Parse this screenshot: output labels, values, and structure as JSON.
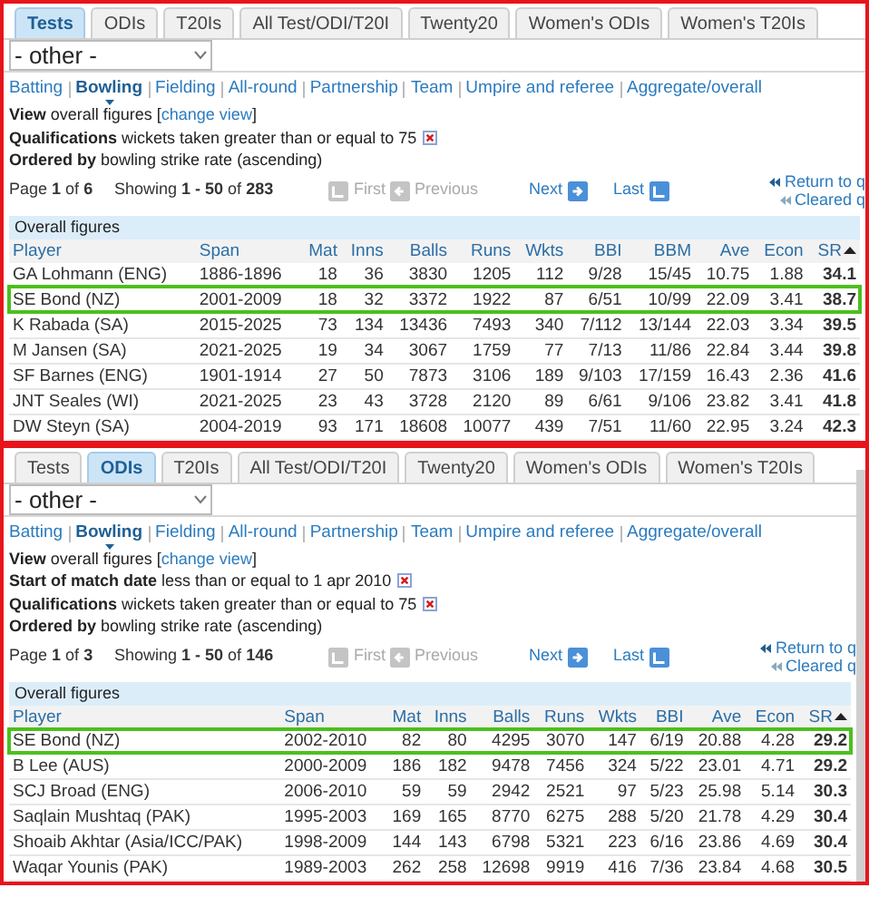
{
  "panels": [
    {
      "tabs": [
        {
          "label": "Tests",
          "selected": true
        },
        {
          "label": "ODIs",
          "selected": false
        },
        {
          "label": "T20Is",
          "selected": false
        },
        {
          "label": "All Test/ODI/T20I",
          "selected": false
        },
        {
          "label": "Twenty20",
          "selected": false
        },
        {
          "label": "Women's ODIs",
          "selected": false
        },
        {
          "label": "Women's T20Is",
          "selected": false
        }
      ],
      "select": "- other -",
      "nav": [
        {
          "label": "Batting",
          "selected": false
        },
        {
          "label": "Bowling",
          "selected": true
        },
        {
          "label": "Fielding",
          "selected": false
        },
        {
          "label": "All-round",
          "selected": false
        },
        {
          "label": "Partnership",
          "selected": false
        },
        {
          "label": "Team",
          "selected": false
        },
        {
          "label": "Umpire and referee",
          "selected": false
        },
        {
          "label": "Aggregate/overall",
          "selected": false
        }
      ],
      "filters": [
        {
          "label": "View",
          "text": "overall figures [",
          "link": "change view",
          "after": "]",
          "removable": false
        },
        {
          "label": "Qualifications",
          "text": "wickets taken greater than or equal to 75",
          "removable": true
        },
        {
          "label": "Ordered by",
          "text": "bowling strike rate (ascending)",
          "removable": false
        }
      ],
      "pager": {
        "page": "Page **1** of **6**",
        "showing": "Showing **1 - 50** of **283**",
        "buttons": [
          {
            "label": "First",
            "kind": "first",
            "disabled": true
          },
          {
            "label": "Previous",
            "kind": "previous",
            "disabled": true
          },
          {
            "label": "Next",
            "kind": "next",
            "disabled": false
          },
          {
            "label": "Last",
            "kind": "last",
            "disabled": false
          }
        ],
        "links": [
          "Return to q",
          "Cleared q"
        ]
      },
      "table": {
        "caption": "Overall figures",
        "columns": [
          {
            "label": "Player",
            "kind": "text",
            "sorted": false
          },
          {
            "label": "Span",
            "kind": "text",
            "sorted": false
          },
          {
            "label": "Mat",
            "kind": "number",
            "sorted": false
          },
          {
            "label": "Inns",
            "kind": "number",
            "sorted": false
          },
          {
            "label": "Balls",
            "kind": "number",
            "sorted": false
          },
          {
            "label": "Runs",
            "kind": "number",
            "sorted": false
          },
          {
            "label": "Wkts",
            "kind": "number",
            "sorted": false
          },
          {
            "label": "BBI",
            "kind": "number",
            "sorted": false
          },
          {
            "label": "BBM",
            "kind": "number",
            "sorted": false
          },
          {
            "label": "Ave",
            "kind": "number",
            "sorted": false
          },
          {
            "label": "Econ",
            "kind": "number",
            "sorted": false
          },
          {
            "label": "SR",
            "kind": "number",
            "sorted": true
          }
        ],
        "rows": [
          {
            "highlighted": false,
            "cells": [
              "GA Lohmann (ENG)",
              "1886-1896",
              "18",
              "36",
              "3830",
              "1205",
              "112",
              "9/28",
              "15/45",
              "10.75",
              "1.88",
              "34.1"
            ]
          },
          {
            "highlighted": true,
            "cells": [
              "SE Bond (NZ)",
              "2001-2009",
              "18",
              "32",
              "3372",
              "1922",
              "87",
              "6/51",
              "10/99",
              "22.09",
              "3.41",
              "38.7"
            ]
          },
          {
            "highlighted": false,
            "cells": [
              "K Rabada (SA)",
              "2015-2025",
              "73",
              "134",
              "13436",
              "7493",
              "340",
              "7/112",
              "13/144",
              "22.03",
              "3.34",
              "39.5"
            ]
          },
          {
            "highlighted": false,
            "cells": [
              "M Jansen (SA)",
              "2021-2025",
              "19",
              "34",
              "3067",
              "1759",
              "77",
              "7/13",
              "11/86",
              "22.84",
              "3.44",
              "39.8"
            ]
          },
          {
            "highlighted": false,
            "cells": [
              "SF Barnes (ENG)",
              "1901-1914",
              "27",
              "50",
              "7873",
              "3106",
              "189",
              "9/103",
              "17/159",
              "16.43",
              "2.36",
              "41.6"
            ]
          },
          {
            "highlighted": false,
            "cells": [
              "JNT Seales (WI)",
              "2021-2025",
              "23",
              "43",
              "3728",
              "2120",
              "89",
              "6/61",
              "9/106",
              "23.82",
              "3.41",
              "41.8"
            ]
          },
          {
            "highlighted": false,
            "cells": [
              "DW Steyn (SA)",
              "2004-2019",
              "93",
              "171",
              "18608",
              "10077",
              "439",
              "7/51",
              "11/60",
              "22.95",
              "3.24",
              "42.3"
            ]
          }
        ]
      }
    },
    {
      "tabs": [
        {
          "label": "Tests",
          "selected": false
        },
        {
          "label": "ODIs",
          "selected": true
        },
        {
          "label": "T20Is",
          "selected": false
        },
        {
          "label": "All Test/ODI/T20I",
          "selected": false
        },
        {
          "label": "Twenty20",
          "selected": false
        },
        {
          "label": "Women's ODIs",
          "selected": false
        },
        {
          "label": "Women's T20Is",
          "selected": false
        }
      ],
      "select": "- other -",
      "nav": [
        {
          "label": "Batting",
          "selected": false
        },
        {
          "label": "Bowling",
          "selected": true
        },
        {
          "label": "Fielding",
          "selected": false
        },
        {
          "label": "All-round",
          "selected": false
        },
        {
          "label": "Partnership",
          "selected": false
        },
        {
          "label": "Team",
          "selected": false
        },
        {
          "label": "Umpire and referee",
          "selected": false
        },
        {
          "label": "Aggregate/overall",
          "selected": false
        }
      ],
      "filters": [
        {
          "label": "View",
          "text": "overall figures [",
          "link": "change view",
          "after": "]",
          "removable": false
        },
        {
          "label": "Start of match date",
          "text": "less than or equal to 1 apr 2010",
          "removable": true
        },
        {
          "label": "Qualifications",
          "text": "wickets taken greater than or equal to 75",
          "removable": true
        },
        {
          "label": "Ordered by",
          "text": "bowling strike rate (ascending)",
          "removable": false
        }
      ],
      "pager": {
        "page": "Page **1** of **3**",
        "showing": "Showing **1 - 50** of **146**",
        "buttons": [
          {
            "label": "First",
            "kind": "first",
            "disabled": true
          },
          {
            "label": "Previous",
            "kind": "previous",
            "disabled": true
          },
          {
            "label": "Next",
            "kind": "next",
            "disabled": false
          },
          {
            "label": "Last",
            "kind": "last",
            "disabled": false
          }
        ],
        "links": [
          "Return to q",
          "Cleared q"
        ]
      },
      "table": {
        "caption": "Overall figures",
        "columns": [
          {
            "label": "Player",
            "kind": "text",
            "sorted": false
          },
          {
            "label": "Span",
            "kind": "text",
            "sorted": false
          },
          {
            "label": "Mat",
            "kind": "number",
            "sorted": false
          },
          {
            "label": "Inns",
            "kind": "number",
            "sorted": false
          },
          {
            "label": "Balls",
            "kind": "number",
            "sorted": false
          },
          {
            "label": "Runs",
            "kind": "number",
            "sorted": false
          },
          {
            "label": "Wkts",
            "kind": "number",
            "sorted": false
          },
          {
            "label": "BBI",
            "kind": "number",
            "sorted": false
          },
          {
            "label": "Ave",
            "kind": "number",
            "sorted": false
          },
          {
            "label": "Econ",
            "kind": "number",
            "sorted": false
          },
          {
            "label": "SR",
            "kind": "number",
            "sorted": true
          }
        ],
        "rows": [
          {
            "highlighted": true,
            "cells": [
              "SE Bond (NZ)",
              "2002-2010",
              "82",
              "80",
              "4295",
              "3070",
              "147",
              "6/19",
              "20.88",
              "4.28",
              "29.2"
            ]
          },
          {
            "highlighted": false,
            "cells": [
              "B Lee (AUS)",
              "2000-2009",
              "186",
              "182",
              "9478",
              "7456",
              "324",
              "5/22",
              "23.01",
              "4.71",
              "29.2"
            ]
          },
          {
            "highlighted": false,
            "cells": [
              "SCJ Broad (ENG)",
              "2006-2010",
              "59",
              "59",
              "2942",
              "2521",
              "97",
              "5/23",
              "25.98",
              "5.14",
              "30.3"
            ]
          },
          {
            "highlighted": false,
            "cells": [
              "Saqlain Mushtaq (PAK)",
              "1995-2003",
              "169",
              "165",
              "8770",
              "6275",
              "288",
              "5/20",
              "21.78",
              "4.29",
              "30.4"
            ]
          },
          {
            "highlighted": false,
            "cells": [
              "Shoaib Akhtar (Asia/ICC/PAK)",
              "1998-2009",
              "144",
              "143",
              "6798",
              "5321",
              "223",
              "6/16",
              "23.86",
              "4.69",
              "30.4"
            ]
          },
          {
            "highlighted": false,
            "cells": [
              "Waqar Younis (PAK)",
              "1989-2003",
              "262",
              "258",
              "12698",
              "9919",
              "416",
              "7/36",
              "23.84",
              "4.68",
              "30.5"
            ]
          }
        ]
      }
    }
  ]
}
